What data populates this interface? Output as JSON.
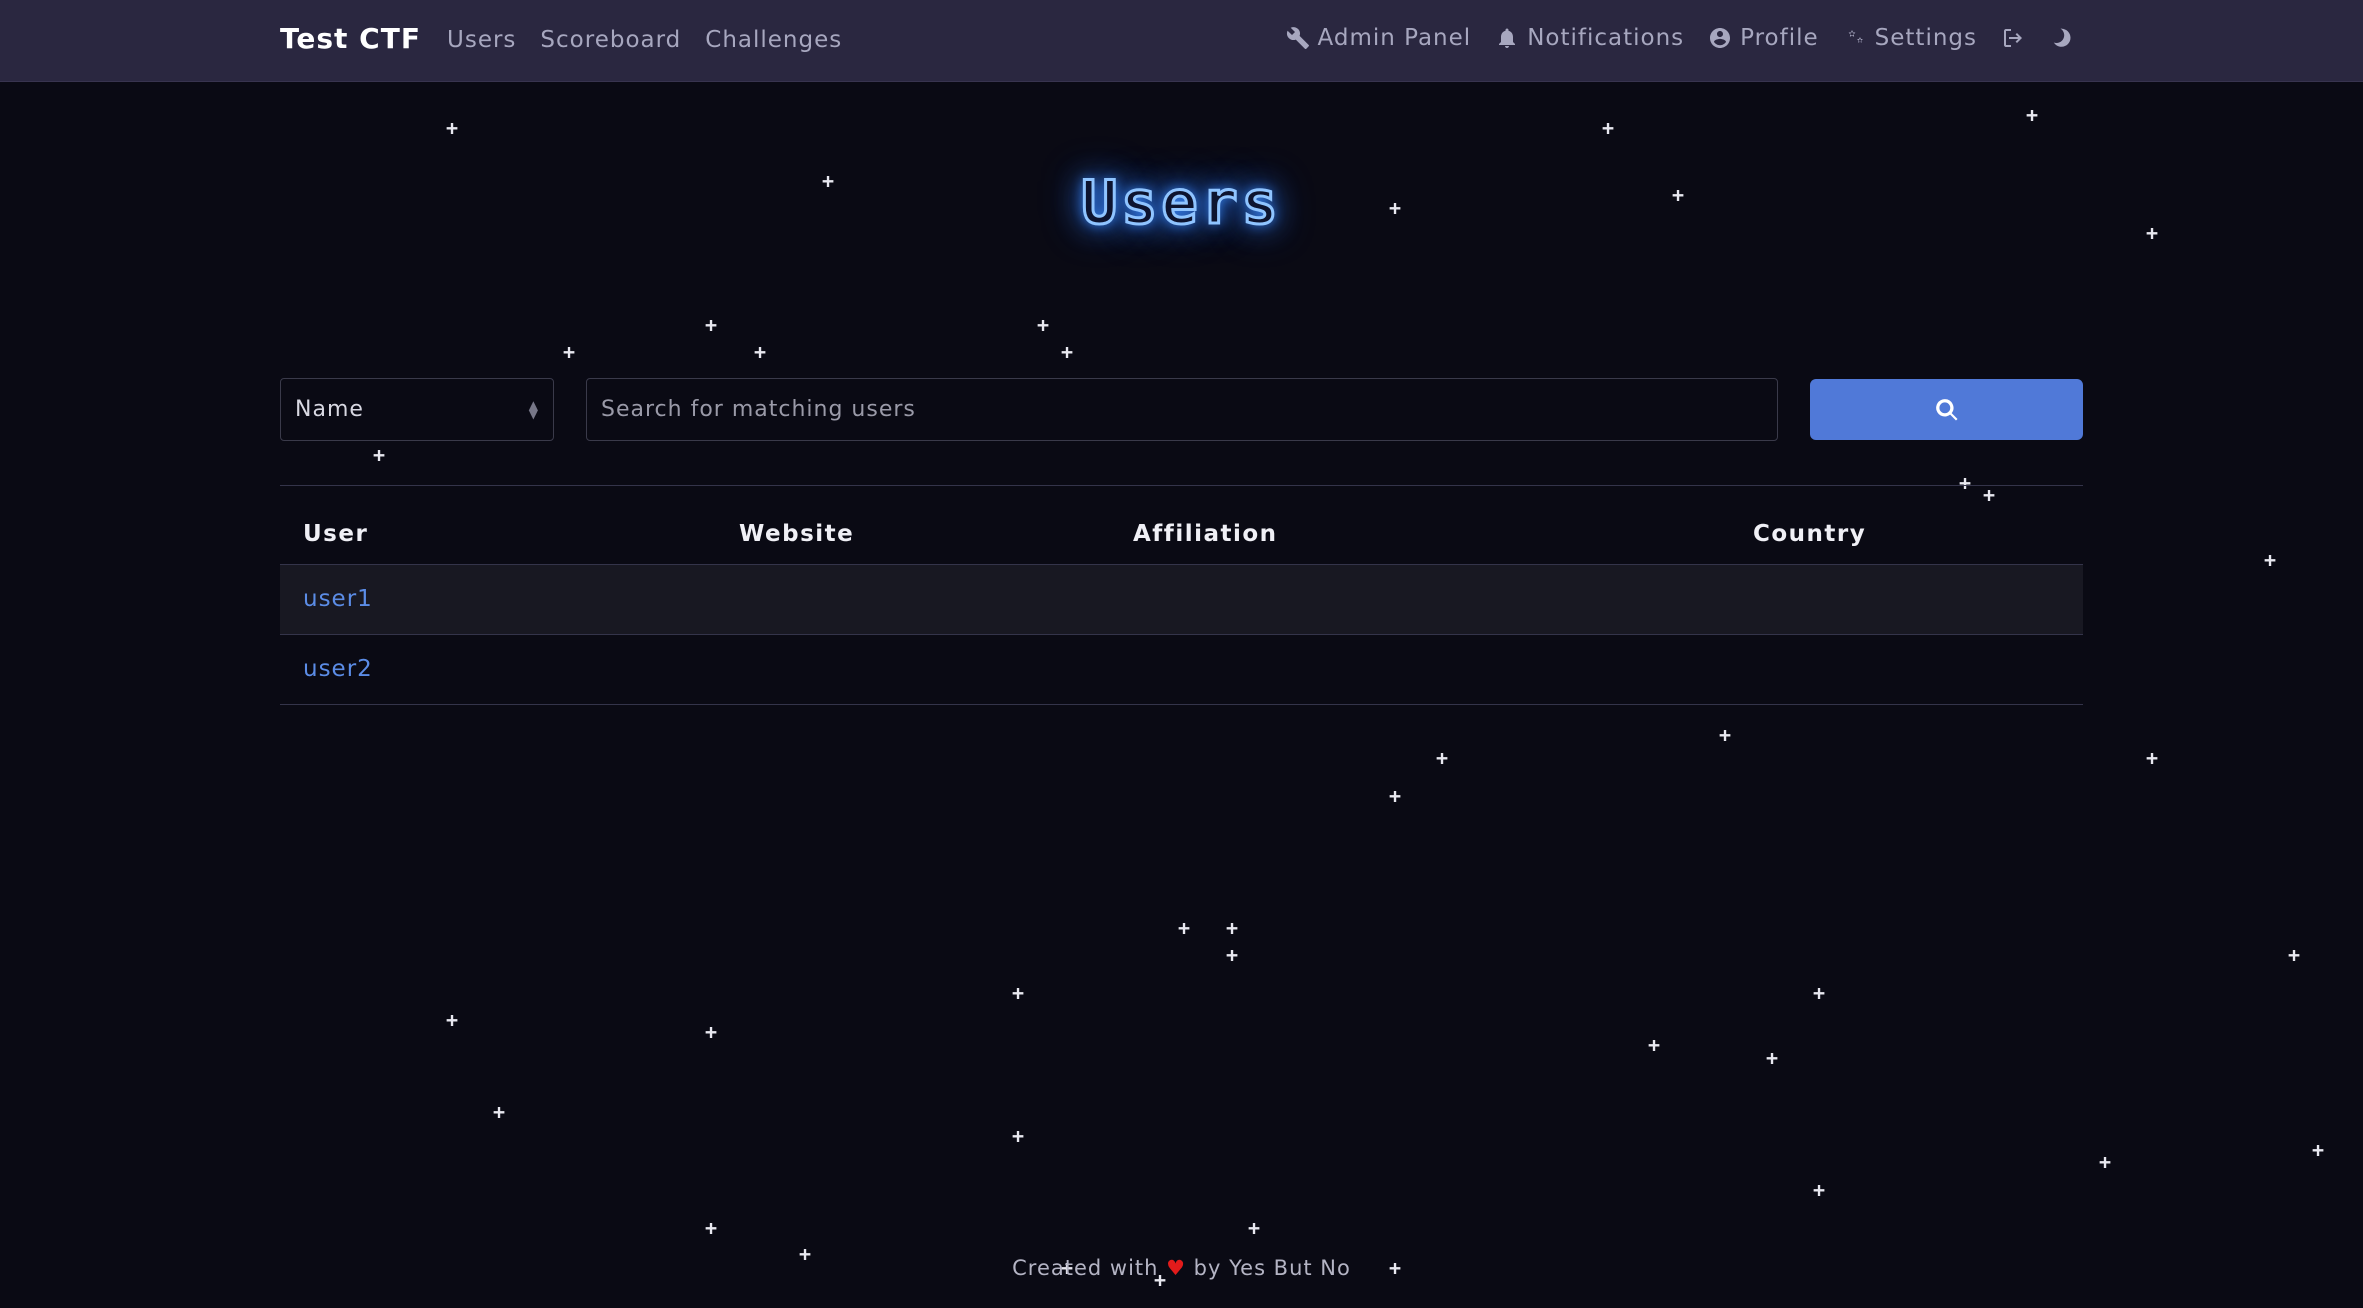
{
  "navbar": {
    "brand": "Test CTF",
    "left_links": [
      "Users",
      "Scoreboard",
      "Challenges"
    ],
    "right_links": {
      "admin": "Admin Panel",
      "notifications": "Notifications",
      "profile": "Profile",
      "settings": "Settings"
    }
  },
  "page": {
    "title": "Users"
  },
  "search": {
    "field_selected": "Name",
    "placeholder": "Search for matching users"
  },
  "table": {
    "headers": [
      "User",
      "Website",
      "Affiliation",
      "Country"
    ],
    "rows": [
      {
        "user": "user1",
        "website": "",
        "affiliation": "",
        "country": ""
      },
      {
        "user": "user2",
        "website": "",
        "affiliation": "",
        "country": ""
      }
    ]
  },
  "footer": {
    "prefix": "Created with",
    "heart": "♥",
    "suffix": "by Yes But No"
  },
  "colors": {
    "background": "#0a0a14",
    "navbar": "#2a2740",
    "accent_button": "#5079d8",
    "link": "#5b8ce6",
    "title_glow": "#3d8bff"
  }
}
